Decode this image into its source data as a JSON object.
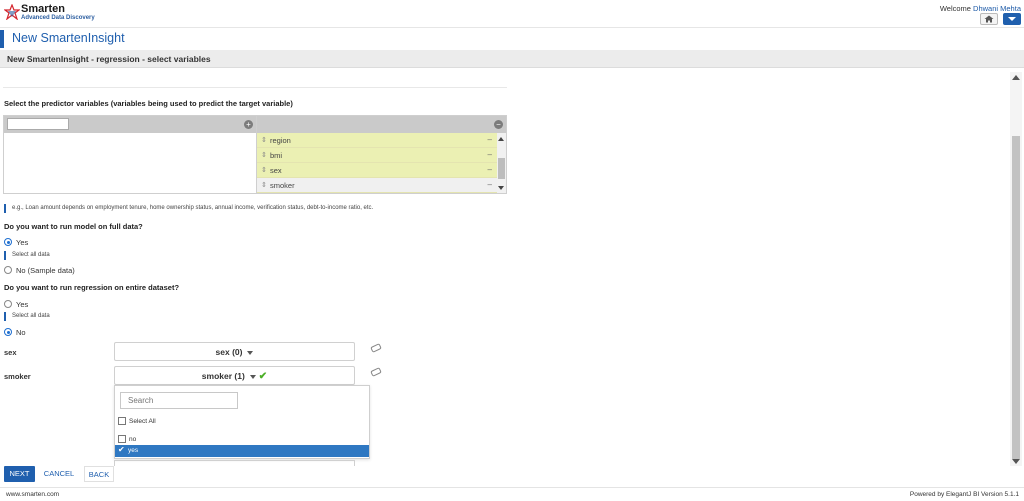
{
  "header": {
    "logo_name": "Smarten",
    "logo_tagline": "Advanced Data Discovery",
    "welcome_text": "Welcome",
    "user_name": "Dhwani Mehta",
    "brand_color": "#1f5fae"
  },
  "page": {
    "title": "New SmartenInsight",
    "subtitle": "New SmartenInsight - regression - select variables"
  },
  "predictors": {
    "label": "Select the predictor variables (variables being used to predict the target variable)",
    "filter_value": "",
    "available": [],
    "selected": [
      {
        "name": "region",
        "highlighted": true
      },
      {
        "name": "bmi",
        "highlighted": true
      },
      {
        "name": "sex",
        "highlighted": true
      },
      {
        "name": "smoker",
        "highlighted": false
      }
    ],
    "hint": "e.g., Loan amount depends on employment tenure, home ownership status, annual income, verification status, debt-to-income ratio, etc."
  },
  "full_data": {
    "question": "Do you want to run model on full data?",
    "options": [
      {
        "label": "Yes",
        "checked": true
      },
      {
        "label": "No (Sample data)",
        "checked": false
      }
    ],
    "note": "Select all data"
  },
  "entire_dataset": {
    "question": "Do you want to run regression on entire dataset?",
    "options": [
      {
        "label": "Yes",
        "checked": false
      },
      {
        "label": "No",
        "checked": true
      }
    ],
    "note": "Select all data"
  },
  "filters": [
    {
      "label": "sex",
      "value": "sex (0)",
      "applied": false
    },
    {
      "label": "smoker",
      "value": "smoker (1)",
      "applied": true
    }
  ],
  "smoker_dropdown": {
    "search_placeholder": "Search",
    "select_all_label": "Select All",
    "options": [
      {
        "label": "no",
        "checked": false
      },
      {
        "label": "yes",
        "checked": true
      }
    ]
  },
  "actions": {
    "next": "NEXT",
    "cancel": "CANCEL",
    "back": "BACK"
  },
  "footer": {
    "site": "www.smarten.com",
    "powered_by": "Powered by ElegantJ BI Version 5.1.1"
  }
}
